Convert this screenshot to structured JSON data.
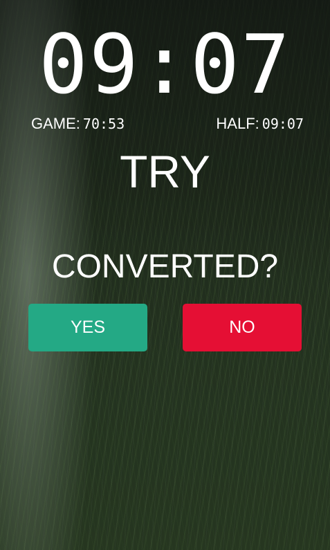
{
  "timer": {
    "main_clock": "09:07",
    "game_label": "GAME:",
    "game_time": "70:53",
    "half_label": "HALF:",
    "half_time": "09:07"
  },
  "event": {
    "title": "TRY",
    "question": "CONVERTED?"
  },
  "buttons": {
    "yes_label": "YES",
    "no_label": "NO"
  },
  "colors": {
    "yes_button": "#24a985",
    "no_button": "#e50f34",
    "text": "#ffffff",
    "background": "#1f2a1c"
  },
  "background_image": "grass-field"
}
